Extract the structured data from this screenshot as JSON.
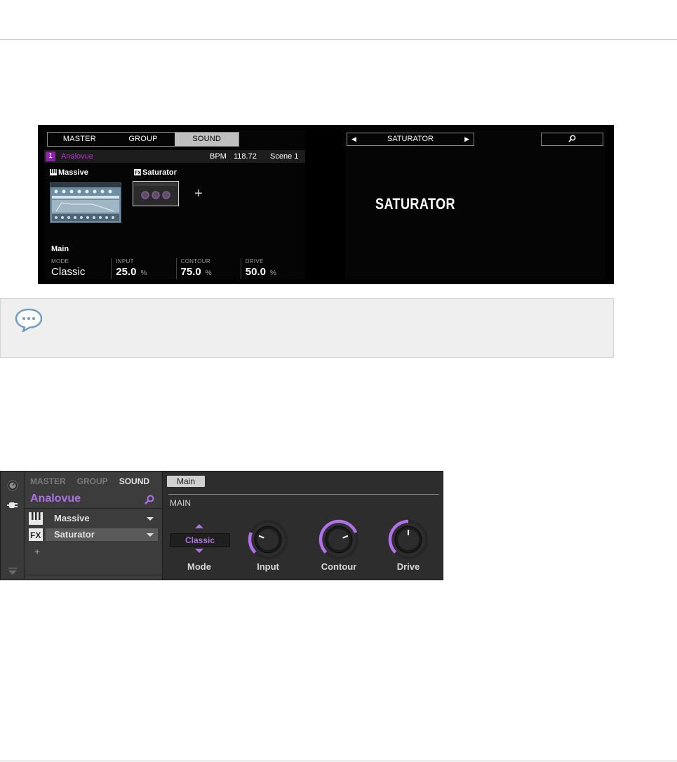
{
  "hardware_display": {
    "tabs": [
      {
        "label": "MASTER",
        "active": false
      },
      {
        "label": "GROUP",
        "active": false
      },
      {
        "label": "SOUND",
        "active": true
      }
    ],
    "slot_number": "1",
    "sound_name": "Analovue",
    "bpm_label": "BPM",
    "bpm_value": "118.72",
    "scene": "Scene 1",
    "plugins": [
      {
        "name": "Massive",
        "icon": "piano-keys-icon"
      },
      {
        "name": "Saturator",
        "icon": "fx-icon"
      }
    ],
    "add_symbol": "+",
    "page_label": "Main",
    "params": [
      {
        "label": "MODE",
        "value": "Classic",
        "unit": ""
      },
      {
        "label": "INPUT",
        "value": "25.0",
        "unit": "%"
      },
      {
        "label": "CONTOUR",
        "value": "75.0",
        "unit": "%"
      },
      {
        "label": "DRIVE",
        "value": "50.0",
        "unit": "%"
      }
    ],
    "browser_title": "SATURATOR",
    "big_title": "SATURATOR",
    "accent": "#b235cd"
  },
  "note": {
    "icon": "speech-bubble-icon"
  },
  "software_panel": {
    "tabs": [
      {
        "label": "MASTER",
        "active": false
      },
      {
        "label": "GROUP",
        "active": false
      },
      {
        "label": "SOUND",
        "active": true
      }
    ],
    "sound_name": "Analovue",
    "slots": [
      {
        "name": "Massive",
        "icon": "piano-keys-icon",
        "selected": false
      },
      {
        "name": "Saturator",
        "icon": "fx-icon",
        "selected": true
      }
    ],
    "add_symbol": "+",
    "page_tab": "Main",
    "section": "MAIN",
    "mode_value": "Classic",
    "controls": [
      {
        "label": "Mode"
      },
      {
        "label": "Input",
        "level": 0.25
      },
      {
        "label": "Contour",
        "level": 0.75
      },
      {
        "label": "Drive",
        "level": 0.5
      }
    ],
    "accent": "#b070e8"
  }
}
